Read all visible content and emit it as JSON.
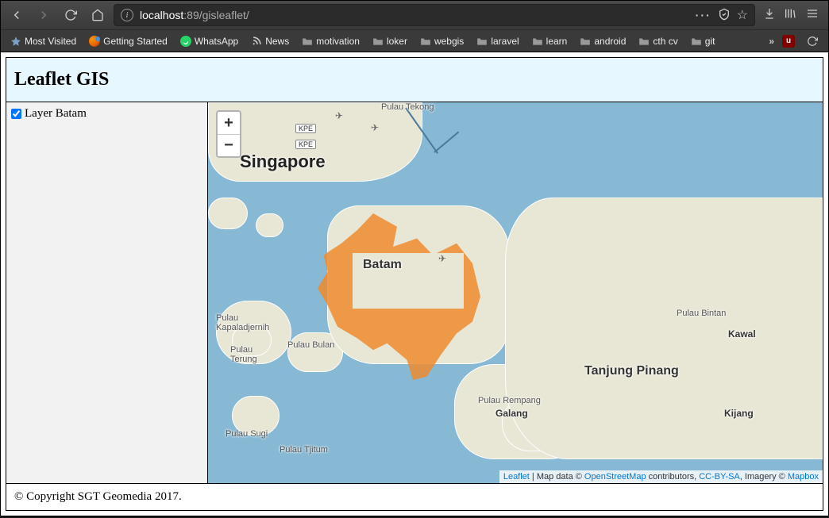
{
  "browser": {
    "url_host": "localhost",
    "url_port": ":89",
    "url_path": "/gisleaflet/",
    "bookmarks": [
      {
        "type": "star",
        "label": "Most Visited"
      },
      {
        "type": "fx",
        "label": "Getting Started"
      },
      {
        "type": "wa",
        "label": "WhatsApp"
      },
      {
        "type": "rss",
        "label": "News"
      },
      {
        "type": "folder",
        "label": "motivation"
      },
      {
        "type": "folder",
        "label": "loker"
      },
      {
        "type": "folder",
        "label": "webgis"
      },
      {
        "type": "folder",
        "label": "laravel"
      },
      {
        "type": "folder",
        "label": "learn"
      },
      {
        "type": "folder",
        "label": "android"
      },
      {
        "type": "folder",
        "label": "cth cv"
      },
      {
        "type": "folder",
        "label": "git"
      }
    ]
  },
  "page": {
    "title": "Leaflet GIS",
    "layer_checkbox_label": "Layer Batam",
    "layer_checked": true,
    "footer": "© Copyright SGT Geomedia 2017."
  },
  "map": {
    "zoom_in": "+",
    "zoom_out": "−",
    "labels": {
      "singapore": "Singapore",
      "batam": "Batam",
      "tanjung_pinang": "Tanjung Pinang",
      "kijang": "Kijang",
      "kawal": "Kawal",
      "pulau_bintan": "Pulau Bintan",
      "galang": "Galang",
      "pulau_rempang": "Pulau Rempang",
      "pulau_bulan": "Pulau Bulan",
      "pulau_terung": "Pulau\nTerung",
      "pulau_kapaladjernih": "Pulau\nKapaladjernih",
      "pulau_sugi": "Pulau Sugi",
      "pulau_tjitum": "Pulau Tjitum",
      "pulau_tekong": "Pulau Tekong",
      "kpe": "KPE"
    },
    "attribution": {
      "leaflet": "Leaflet",
      "sep1": " | Map data © ",
      "osm": "OpenStreetMap",
      "sep2": " contributors, ",
      "ccbysa": "CC-BY-SA",
      "sep3": ", Imagery © ",
      "mapbox": "Mapbox"
    }
  }
}
